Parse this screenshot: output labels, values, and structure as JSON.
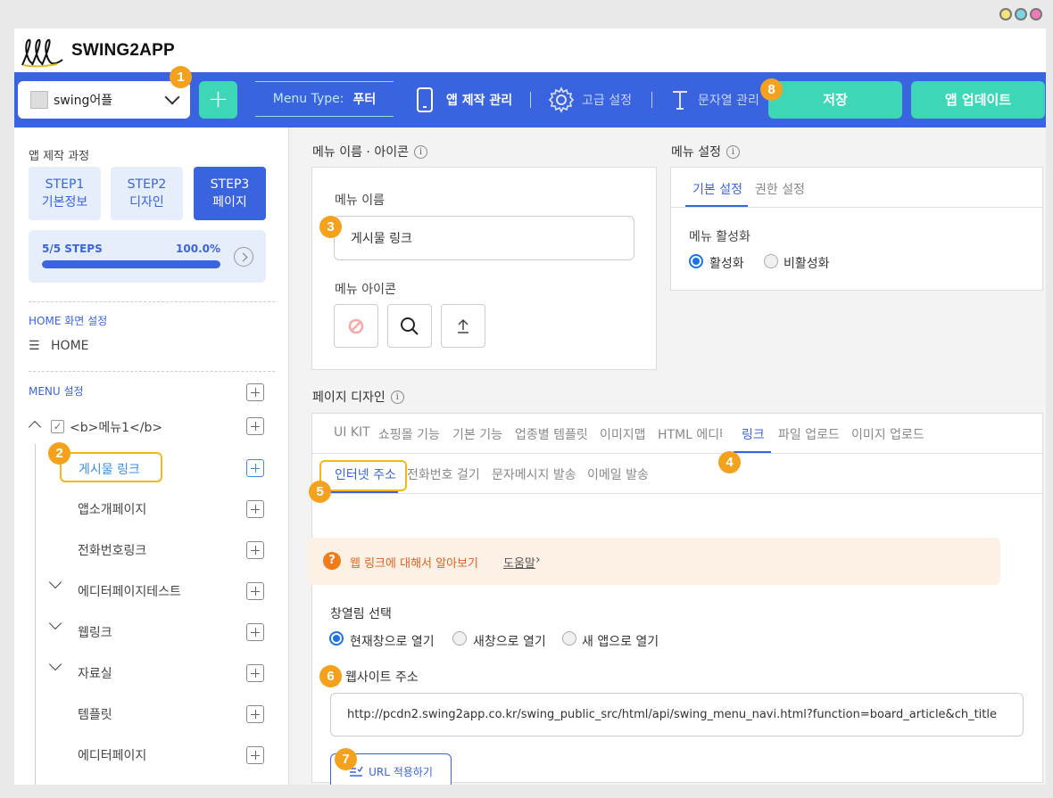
{
  "header": {
    "logo_text": "SWING2APP",
    "app_select_value": "swing어플",
    "add_label": "+",
    "menu_type_key": "Menu Type:",
    "menu_type_value": "푸터",
    "nav_app_manage": "앱 제작 관리",
    "nav_advanced": "고급 설정",
    "nav_strings": "문자열 관리",
    "save_label": "저장",
    "update_label": "앱 업데이트"
  },
  "badges": [
    "1",
    "2",
    "3",
    "4",
    "5",
    "6",
    "7",
    "8"
  ],
  "sidebar": {
    "process_title": "앱 제작 과정",
    "steps": [
      {
        "line1": "STEP1",
        "line2": "기본정보"
      },
      {
        "line1": "STEP2",
        "line2": "디자인"
      },
      {
        "line1": "STEP3",
        "line2": "페이지"
      }
    ],
    "progress_label": "5/5 STEPS",
    "progress_pct_text": "100.0%",
    "progress_value": 1.0,
    "home_section": "HOME 화면 설정",
    "home_item": "HOME",
    "menu_section": "MENU 설정",
    "menu_root": "<b>메뉴1</b>",
    "items": [
      "게시물 링크",
      "앱소개페이지",
      "전화번호링크",
      "에디터페이지테스트",
      "웹링크",
      "자료실",
      "템플릿",
      "에디터페이지"
    ]
  },
  "menu_name_panel": {
    "title": "메뉴 이름 · 아이콘",
    "name_label": "메뉴 이름",
    "name_value": "게시물 링크",
    "icon_label": "메뉴 아이콘"
  },
  "menu_settings_panel": {
    "title": "메뉴 설정",
    "tabs": [
      "기본 설정",
      "권한 설정"
    ],
    "activation_label": "메뉴 활성화",
    "options": [
      "활성화",
      "비활성화"
    ]
  },
  "page_design": {
    "title": "페이지 디자인",
    "tabs": [
      "UI KIT",
      "쇼핑몰 기능",
      "기본 기능",
      "업종별 템플릿",
      "이미지맵",
      "HTML 에디터",
      "링크",
      "파일 업로드",
      "이미지 업로드"
    ],
    "subtabs": [
      "인터넷 주소",
      "전화번호 걸기",
      "문자메시지 발송",
      "이메일 발송"
    ],
    "notice_text": "웹 링크에 대해서 알아보기",
    "notice_help": "도움말",
    "window_label": "창열림 선택",
    "window_options": [
      "현재창으로 열기",
      "새창으로 열기",
      "새 앱으로 열기"
    ],
    "website_label": "웹사이트 주소",
    "website_value": "http://pcdn2.swing2app.co.kr/swing_public_src/html/api/swing_menu_navi.html?function=board_article&ch_title",
    "apply_button": "URL 적용하기"
  },
  "colors": {
    "primary": "#3a63e0",
    "accent": "#3dd6b7",
    "badge": "#f4a21d",
    "notice": "#e2621f"
  }
}
